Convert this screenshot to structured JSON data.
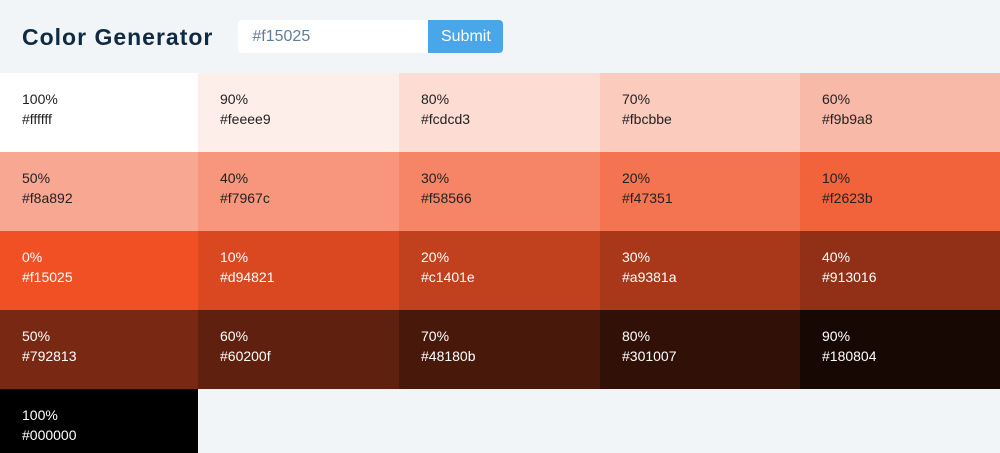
{
  "header": {
    "title": "Color Generator",
    "input_value": "#f15025",
    "submit_label": "Submit"
  },
  "colors": [
    {
      "weight": "100%",
      "hex": "#ffffff",
      "tone": "light"
    },
    {
      "weight": "90%",
      "hex": "#feeee9",
      "tone": "light"
    },
    {
      "weight": "80%",
      "hex": "#fcdcd3",
      "tone": "light"
    },
    {
      "weight": "70%",
      "hex": "#fbcbbe",
      "tone": "light"
    },
    {
      "weight": "60%",
      "hex": "#f9b9a8",
      "tone": "light"
    },
    {
      "weight": "50%",
      "hex": "#f8a892",
      "tone": "light"
    },
    {
      "weight": "40%",
      "hex": "#f7967c",
      "tone": "light"
    },
    {
      "weight": "30%",
      "hex": "#f58566",
      "tone": "light"
    },
    {
      "weight": "20%",
      "hex": "#f47351",
      "tone": "light"
    },
    {
      "weight": "10%",
      "hex": "#f2623b",
      "tone": "light"
    },
    {
      "weight": "0%",
      "hex": "#f15025",
      "tone": "dark"
    },
    {
      "weight": "10%",
      "hex": "#d94821",
      "tone": "dark"
    },
    {
      "weight": "20%",
      "hex": "#c1401e",
      "tone": "dark"
    },
    {
      "weight": "30%",
      "hex": "#a9381a",
      "tone": "dark"
    },
    {
      "weight": "40%",
      "hex": "#913016",
      "tone": "dark"
    },
    {
      "weight": "50%",
      "hex": "#792813",
      "tone": "dark"
    },
    {
      "weight": "60%",
      "hex": "#60200f",
      "tone": "dark"
    },
    {
      "weight": "70%",
      "hex": "#48180b",
      "tone": "dark"
    },
    {
      "weight": "80%",
      "hex": "#301007",
      "tone": "dark"
    },
    {
      "weight": "90%",
      "hex": "#180804",
      "tone": "dark"
    },
    {
      "weight": "100%",
      "hex": "#000000",
      "tone": "dark"
    }
  ]
}
